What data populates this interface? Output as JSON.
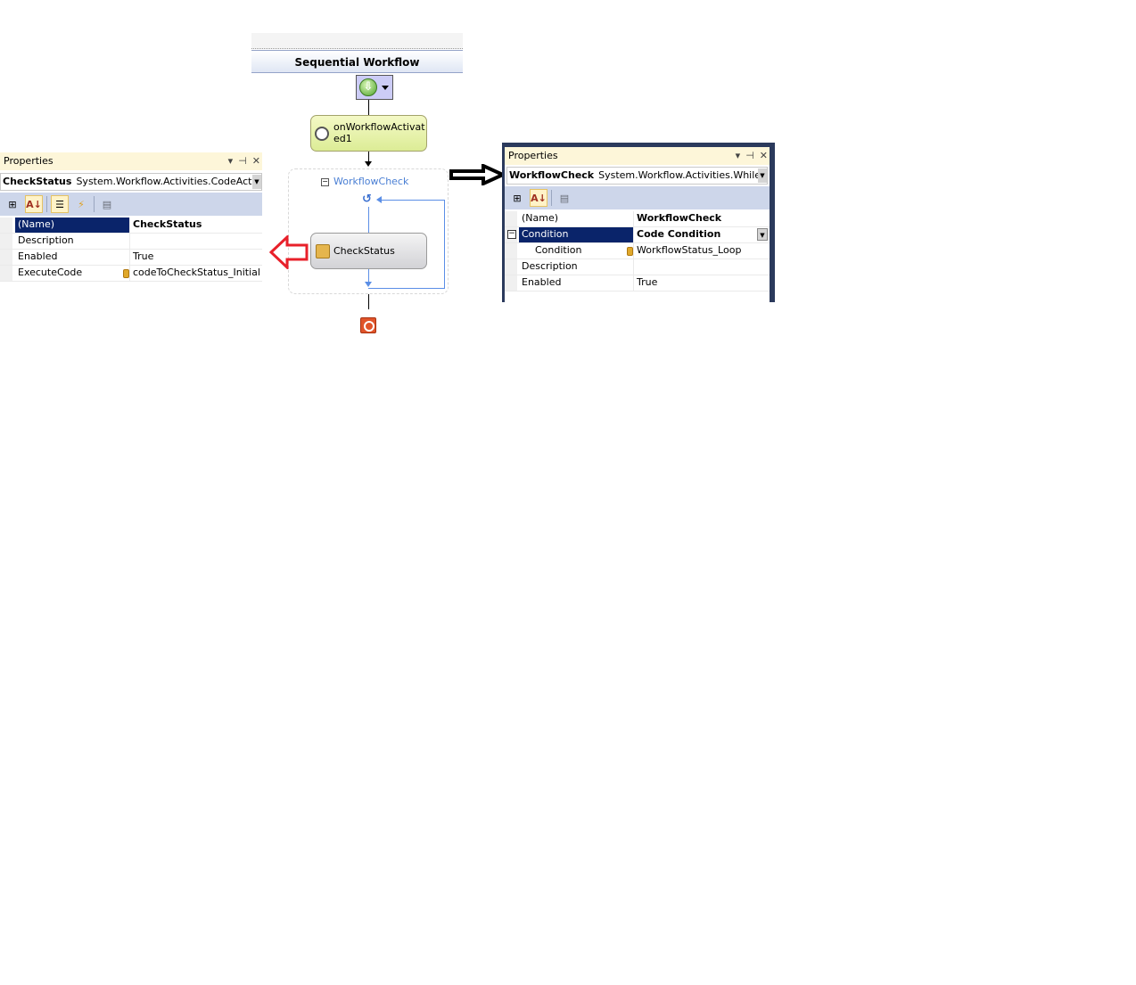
{
  "left_panel": {
    "title": "Properties",
    "title_buttons": [
      "▾",
      "⊣",
      "✕"
    ],
    "selected_object": {
      "name": "CheckStatus",
      "type": "System.Workflow.Activities.CodeActivity"
    },
    "toolbar": [
      {
        "icon": "categorized-icon",
        "label": "Categorized"
      },
      {
        "icon": "alphabetical-icon",
        "label": "Alphabetical",
        "active": true
      },
      {
        "icon": "properties-icon",
        "label": "Properties",
        "active": true
      },
      {
        "icon": "events-icon",
        "label": "Events"
      },
      {
        "icon": "property-pages-icon",
        "label": "Property Pages",
        "disabled": true
      }
    ],
    "rows": [
      {
        "name": "(Name)",
        "value": "CheckStatus",
        "selected": true,
        "bold": true
      },
      {
        "name": "Description",
        "value": ""
      },
      {
        "name": "Enabled",
        "value": "True"
      },
      {
        "name": "ExecuteCode",
        "value": "codeToCheckStatus_Initial",
        "event": true
      }
    ]
  },
  "designer": {
    "title": "Sequential Workflow",
    "activities": [
      {
        "name": "onWorkflowActivated1",
        "label": "onWorkflowActivat\ned1"
      },
      {
        "name": "WorkflowCheck",
        "label": "WorkflowCheck"
      },
      {
        "name": "CheckStatus",
        "label": "CheckStatus"
      }
    ]
  },
  "right_panel": {
    "title": "Properties",
    "title_buttons": [
      "▾",
      "⊣",
      "✕"
    ],
    "selected_object": {
      "name": "WorkflowCheck",
      "type": "System.Workflow.Activities.WhileActiv"
    },
    "toolbar": [
      {
        "icon": "categorized-icon",
        "label": "Categorized"
      },
      {
        "icon": "alphabetical-icon",
        "label": "Alphabetical",
        "active": true
      },
      {
        "icon": "property-pages-icon",
        "label": "Property Pages",
        "disabled": true
      }
    ],
    "rows": [
      {
        "name": "(Name)",
        "value": "WorkflowCheck",
        "bold": true
      },
      {
        "name": "Condition",
        "value": "Code Condition",
        "selected": true,
        "bold": true,
        "expandable": true,
        "dropdown": true
      },
      {
        "name": "Condition",
        "value": "WorkflowStatus_Loop",
        "indent": true,
        "event": true
      },
      {
        "name": "Description",
        "value": ""
      },
      {
        "name": "Enabled",
        "value": "True"
      }
    ]
  },
  "annotations": {
    "red_arrow_color": "#e8202a",
    "black_arrow_color": "#000000"
  }
}
